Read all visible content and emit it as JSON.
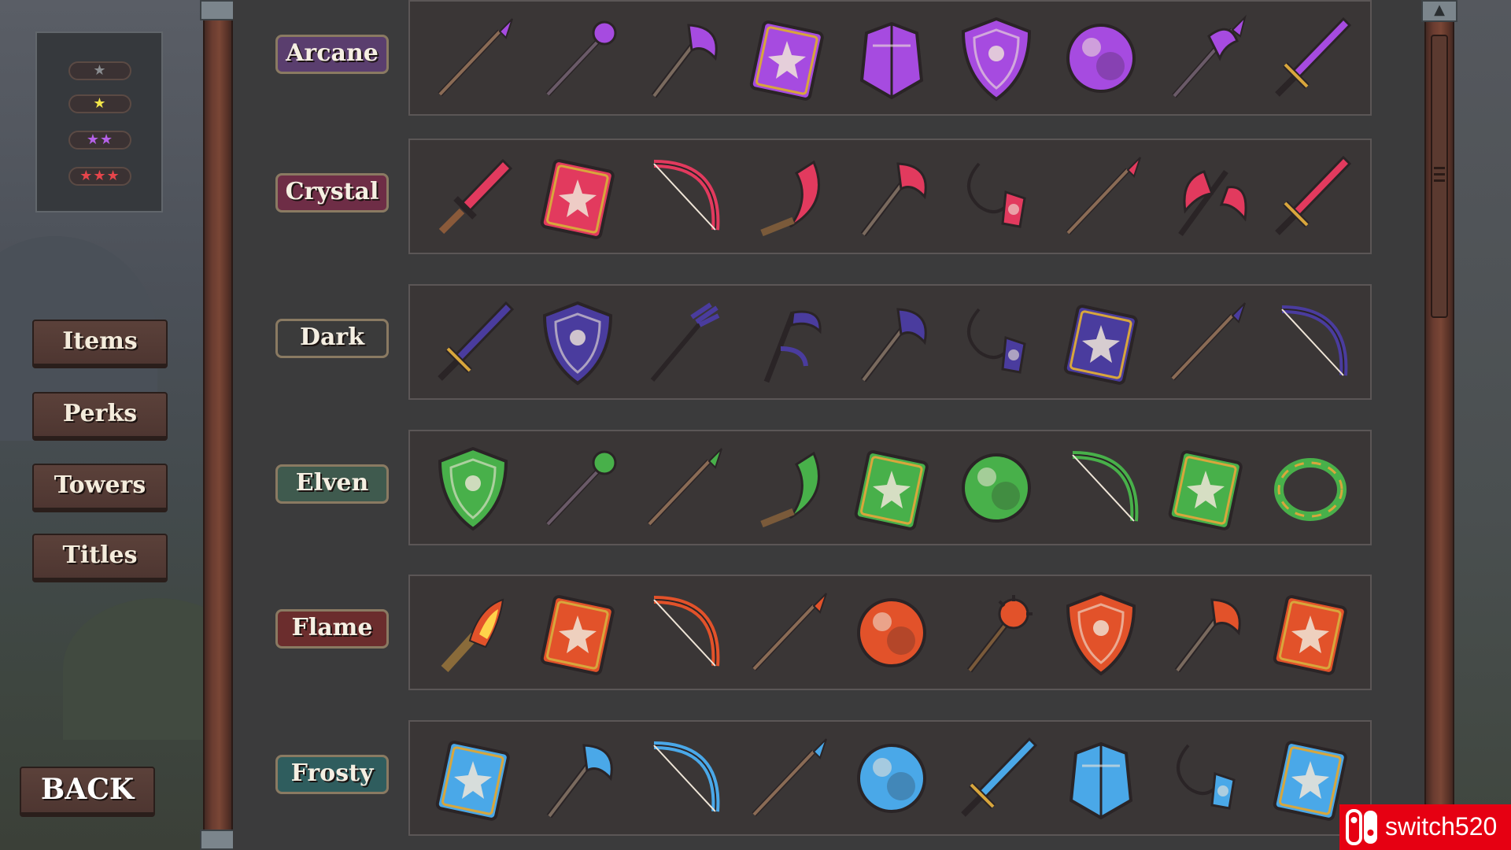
{
  "rarity_filters": [
    {
      "stars": "★",
      "color": "#8a8d90"
    },
    {
      "stars": "★",
      "color": "#f2e64a"
    },
    {
      "stars": "★★",
      "color": "#b561e8"
    },
    {
      "stars": "★★★",
      "color": "#e6454b"
    }
  ],
  "menu": {
    "items": "Items",
    "perks": "Perks",
    "towers": "Towers",
    "titles": "Titles",
    "back": "BACK"
  },
  "categories": [
    {
      "label": "Arcane",
      "color": "#5a3e6e",
      "items": [
        "spear",
        "staff",
        "axe",
        "spellbook",
        "armor",
        "shield",
        "orb",
        "halberd",
        "sword"
      ]
    },
    {
      "label": "Crystal",
      "color": "#6e2d46",
      "items": [
        "dagger",
        "spellbook",
        "bow",
        "sickle",
        "axe",
        "amulet",
        "spear",
        "double-axe",
        "sword"
      ]
    },
    {
      "label": "Dark",
      "color": "#3b3b3b",
      "items": [
        "sword",
        "shield",
        "trident",
        "scythe",
        "axe",
        "amulet",
        "spellbook",
        "spear",
        "bow"
      ]
    },
    {
      "label": "Elven",
      "color": "#3f5a4e",
      "items": [
        "shield",
        "staff",
        "spear",
        "sickle",
        "spellbook",
        "orb",
        "bow",
        "spellbook",
        "bracelet"
      ]
    },
    {
      "label": "Flame",
      "color": "#6b2d2d",
      "items": [
        "torch",
        "spellbook",
        "bow",
        "spear",
        "orb",
        "mace",
        "shield",
        "axe",
        "spellbook"
      ]
    },
    {
      "label": "Frosty",
      "color": "#2f5d5e",
      "items": [
        "spellbook",
        "axe",
        "bow",
        "spear",
        "orb",
        "sword",
        "armor",
        "amulet",
        "spellbook"
      ]
    }
  ],
  "watermark": "switch520"
}
